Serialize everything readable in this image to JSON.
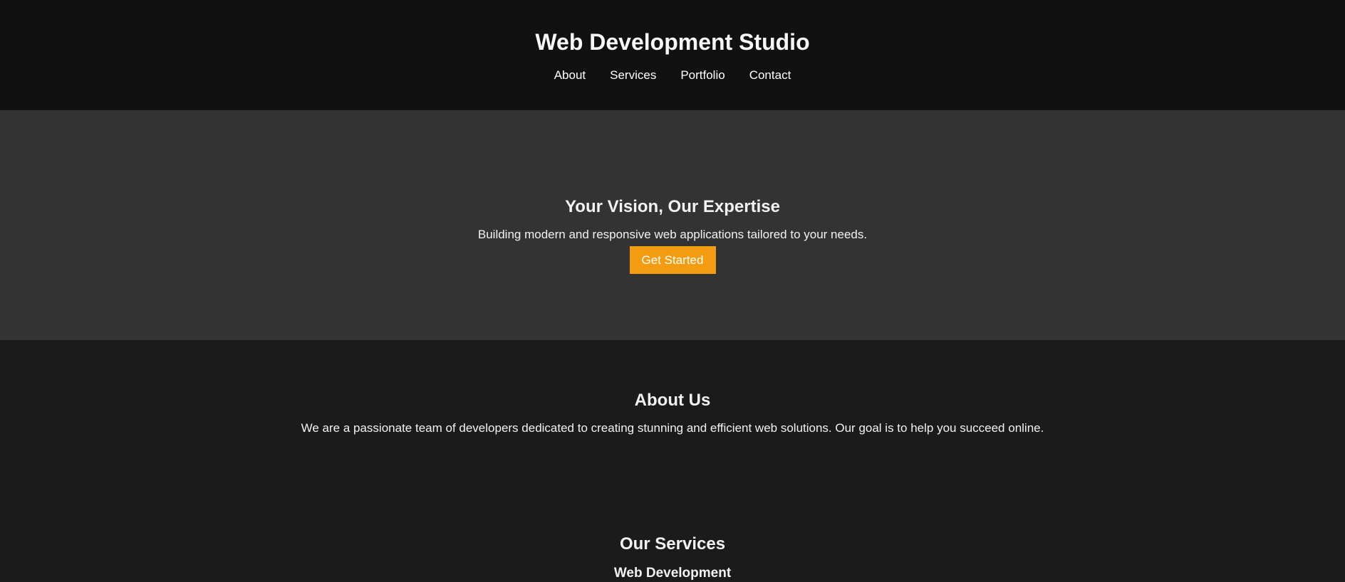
{
  "header": {
    "title": "Web Development Studio",
    "nav": [
      {
        "label": "About"
      },
      {
        "label": "Services"
      },
      {
        "label": "Portfolio"
      },
      {
        "label": "Contact"
      }
    ]
  },
  "hero": {
    "title": "Your Vision, Our Expertise",
    "subtitle": "Building modern and responsive web applications tailored to your needs.",
    "cta_label": "Get Started"
  },
  "about": {
    "title": "About Us",
    "text": "We are a passionate team of developers dedicated to creating stunning and efficient web solutions. Our goal is to help you succeed online."
  },
  "services": {
    "title": "Our Services",
    "items": [
      {
        "name": "Web Development"
      }
    ]
  },
  "colors": {
    "header_bg": "#111111",
    "hero_bg": "#333333",
    "page_bg": "#1b1b1b",
    "accent": "#f39c12"
  }
}
